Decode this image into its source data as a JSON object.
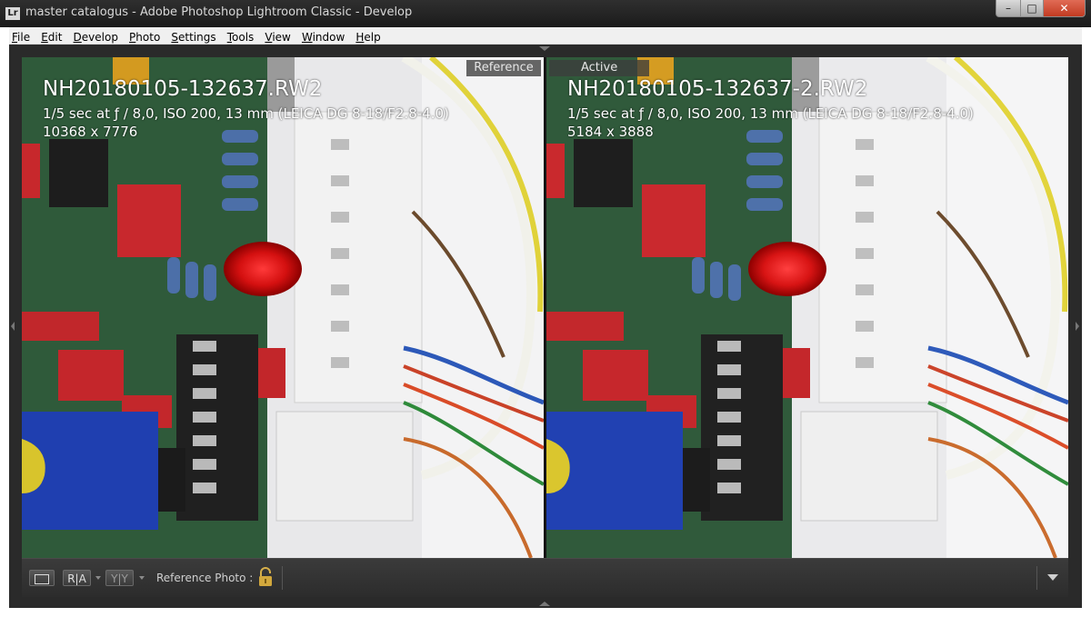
{
  "window": {
    "title": "master catalogus - Adobe Photoshop Lightroom Classic - Develop",
    "app_icon_text": "Lr",
    "minimize_label": "–",
    "maximize_label": "□",
    "close_label": "✕"
  },
  "menu": [
    {
      "first": "F",
      "rest": "ile"
    },
    {
      "first": "E",
      "rest": "dit"
    },
    {
      "first": "D",
      "rest": "evelop"
    },
    {
      "first": "P",
      "rest": "hoto"
    },
    {
      "first": "S",
      "rest": "ettings"
    },
    {
      "first": "T",
      "rest": "ools"
    },
    {
      "first": "V",
      "rest": "iew"
    },
    {
      "first": "W",
      "rest": "indow"
    },
    {
      "first": "H",
      "rest": "elp"
    }
  ],
  "reference": {
    "tag": "Reference",
    "filename": "NH20180105-132637.RW2",
    "exif": "1/5 sec at ƒ / 8,0, ISO 200, 13 mm (LEICA DG 8-18/F2.8-4.0)",
    "dimensions": "10368 x 7776"
  },
  "active": {
    "tag": "Active",
    "filename": "NH20180105-132637-2.RW2",
    "exif": "1/5 sec at ƒ / 8,0, ISO 200, 13 mm (LEICA DG 8-18/F2.8-4.0)",
    "dimensions": "5184 x 3888"
  },
  "toolbar": {
    "ra_label": "R|A",
    "yy_label": "Y|Y",
    "reference_photo_label": "Reference Photo :"
  },
  "icons": {
    "lock": "lock-icon",
    "view_mode": "loupe-view-icon",
    "toolbar_menu": "triangle-down-icon"
  }
}
